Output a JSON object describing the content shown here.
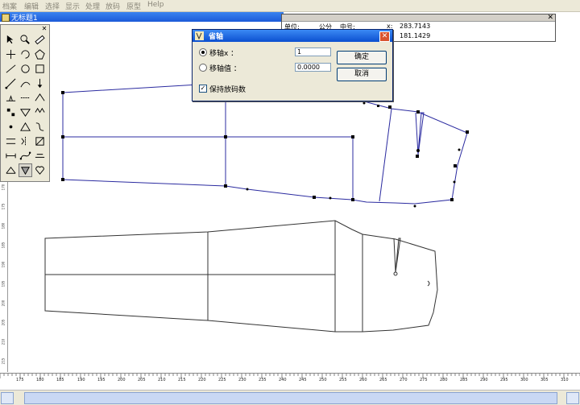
{
  "menu": [
    "档案",
    "编辑",
    "选择",
    "显示",
    "处理",
    "放码",
    "原型",
    "Help"
  ],
  "document": {
    "title": "无标题1"
  },
  "info_panel": {
    "unit_label": "单位:",
    "unit_value": "公分",
    "code_label": "中号:",
    "x_label": "x:",
    "x_value": "283.7143",
    "y_label": "y:",
    "y_value": "181.1429",
    "close": "✕"
  },
  "dialog": {
    "title": "省轴",
    "option_move_x": "移轴x ：",
    "option_move_value": "移轴值 ：",
    "field_x": "1",
    "field_value": "0.0000",
    "ok": "确定",
    "cancel": "取消",
    "keep_grading": "保持放码数",
    "keep_grading_checked": true,
    "close": "✕"
  },
  "palette": {
    "close": "✕",
    "tools": [
      "arrow-select-icon",
      "zoom-icon",
      "ruler-icon",
      "cross-cut-icon",
      "rotate-icon",
      "polygon-icon",
      "line-icon",
      "circle-icon",
      "rectangle-icon",
      "diagonal-line-icon",
      "curve-icon",
      "arrow-down-icon",
      "notch-icon",
      "seam-icon",
      "dart-icon",
      "grade-icon",
      "fold-icon",
      "pleat-icon",
      "point-icon",
      "triangle-icon",
      "shape-icon",
      "align-icon",
      "mirror-icon",
      "scale-icon",
      "measure-icon",
      "bezier-icon",
      "stretch-icon",
      "edge-icon",
      "dart-fold-icon",
      "heart-icon"
    ]
  },
  "hruler_labels": [
    "175",
    "180",
    "185",
    "190",
    "195",
    "200",
    "205",
    "210",
    "215",
    "220",
    "225",
    "230",
    "235",
    "240",
    "245",
    "250",
    "255",
    "260",
    "265",
    "270",
    "275",
    "280",
    "285",
    "290",
    "295",
    "300",
    "305",
    "310"
  ],
  "vruler_labels": [
    "170",
    "175",
    "180",
    "185",
    "190",
    "195",
    "200",
    "205",
    "210",
    "215"
  ],
  "colors": {
    "pattern_line": "#2b2ba0",
    "titlebar": "#1c5ad8",
    "accent": "#0a246a"
  }
}
